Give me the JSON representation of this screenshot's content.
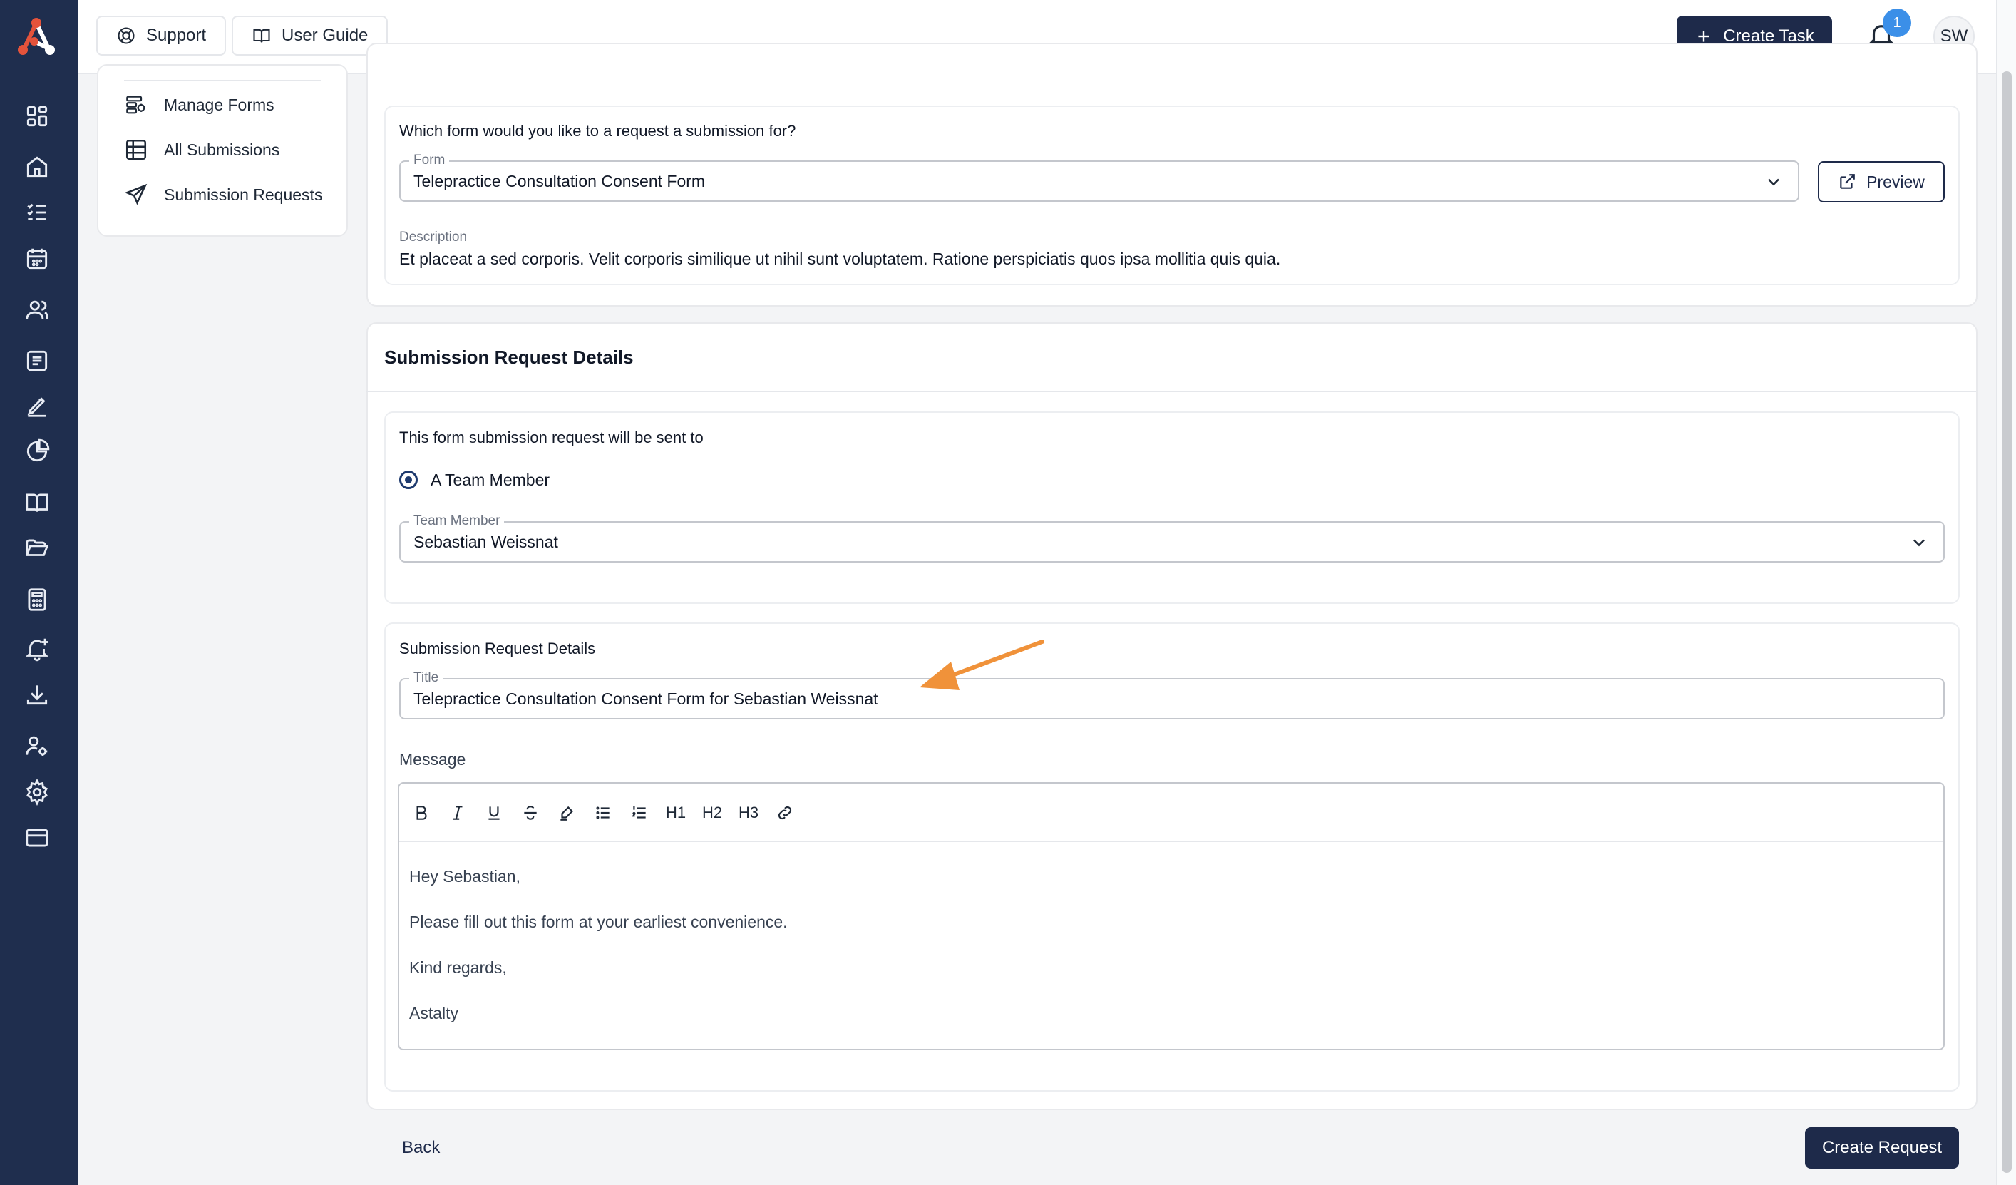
{
  "topbar": {
    "support_label": "Support",
    "user_guide_label": "User Guide",
    "create_task_label": "Create Task",
    "notification_count": "1",
    "avatar_initials": "SW"
  },
  "subnav": {
    "items": [
      {
        "label": "Manage Forms",
        "icon": "forms-icon"
      },
      {
        "label": "All Submissions",
        "icon": "table-icon"
      },
      {
        "label": "Submission Requests",
        "icon": "send-icon"
      }
    ]
  },
  "form_select": {
    "question": "Which form would you like to a request a submission for?",
    "field_label": "Form",
    "selected": "Telepractice Consultation Consent Form",
    "preview_label": "Preview",
    "description_label": "Description",
    "description": "Et placeat a sed corporis. Velit corporis similique ut nihil sunt voluptatem. Ratione perspiciatis quos ipsa mollitia quis quia."
  },
  "details_section": {
    "title": "Submission Request Details",
    "recipient": {
      "question": "This form submission request will be sent to",
      "option_label": "A Team Member",
      "field_label": "Team Member",
      "selected": "Sebastian Weissnat"
    },
    "request": {
      "heading": "Submission Request Details",
      "title_label": "Title",
      "title_value": "Telepractice Consultation Consent Form for Sebastian Weissnat",
      "message_label": "Message",
      "toolbar": [
        "bold-icon",
        "italic-icon",
        "underline-icon",
        "strikethrough-icon",
        "highlight-icon",
        "bullet-list-icon",
        "ordered-list-icon",
        "H1",
        "H2",
        "H3",
        "link-icon"
      ],
      "message_lines": [
        "Hey Sebastian,",
        "Please fill out this form at your earliest convenience.",
        "Kind regards,",
        "Astalty"
      ]
    }
  },
  "footer": {
    "back_label": "Back",
    "create_request_label": "Create Request"
  },
  "colors": {
    "rail": "#1f2e4e",
    "primary": "#1e2a4a",
    "badge": "#3b8fe8",
    "annotation_arrow": "#f0923a"
  }
}
